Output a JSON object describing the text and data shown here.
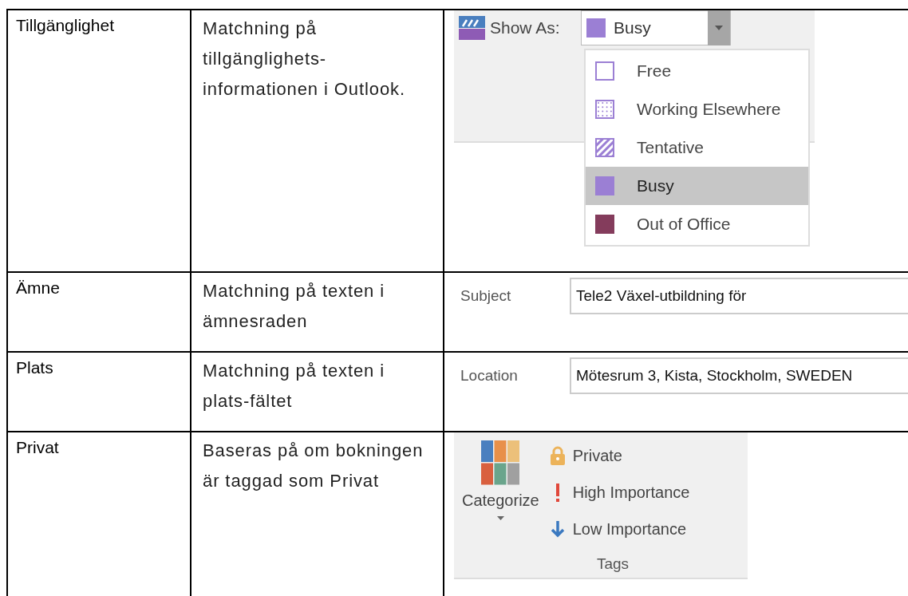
{
  "rows": [
    {
      "term": "Tillgänglighet",
      "description": "Matchning på tillgänglighets-informationen i Outlook.",
      "illustration": {
        "kind": "show_as",
        "label": "Show As:",
        "value": "Busy",
        "color": "#9b7fd4",
        "options": [
          {
            "label": "Free",
            "kind": "empty",
            "color": "#9b7fd4",
            "selected": false
          },
          {
            "label": "Working Elsewhere",
            "kind": "dots",
            "color": "#9b7fd4",
            "selected": false
          },
          {
            "label": "Tentative",
            "kind": "stripes",
            "color": "#9b7fd4",
            "selected": false
          },
          {
            "label": "Busy",
            "kind": "solid",
            "color": "#9b7fd4",
            "selected": true
          },
          {
            "label": "Out of Office",
            "kind": "solid",
            "color": "#843c5c",
            "selected": false
          }
        ]
      }
    },
    {
      "term": "Ämne",
      "description": "Matchning på texten i ämnesraden",
      "illustration": {
        "kind": "field",
        "label": "Subject",
        "value": "Tele2 Växel-utbildning för"
      }
    },
    {
      "term": "Plats",
      "description": "Matchning på texten i plats-fältet",
      "illustration": {
        "kind": "field",
        "label": "Location",
        "value": "Mötesrum 3, Kista, Stockholm, SWEDEN"
      }
    },
    {
      "term": "Privat",
      "description": "Baseras på om bokningen är taggad som Privat",
      "illustration": {
        "kind": "tags",
        "button": "Categorize",
        "group": "Tags",
        "items": [
          {
            "kind": "lock",
            "label": "Private"
          },
          {
            "kind": "high",
            "label": "High Importance"
          },
          {
            "kind": "low",
            "label": "Low Importance"
          }
        ]
      }
    }
  ]
}
